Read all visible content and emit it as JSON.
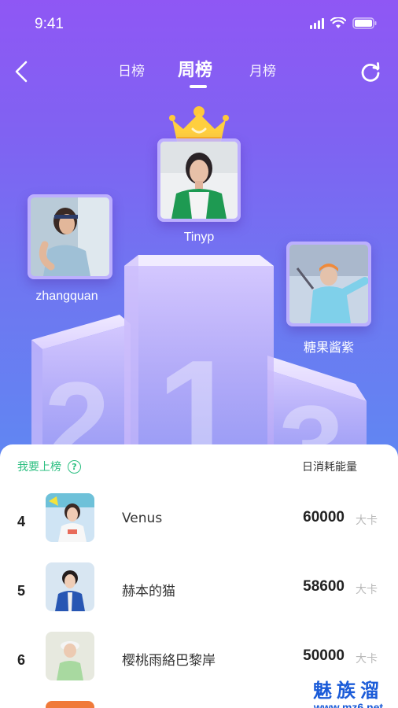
{
  "status_bar": {
    "time": "9:41"
  },
  "nav": {
    "tabs": [
      {
        "label": "日榜",
        "active": false
      },
      {
        "label": "周榜",
        "active": true
      },
      {
        "label": "月榜",
        "active": false
      }
    ]
  },
  "podium": {
    "first": {
      "rank": "1",
      "name": "Tinyp"
    },
    "second": {
      "rank": "2",
      "name": "zhangquan"
    },
    "third": {
      "rank": "3",
      "name": "糖果酱紫"
    }
  },
  "list": {
    "join_label": "我要上榜",
    "help_label": "?",
    "column_label": "日消耗能量",
    "unit": "大卡",
    "rows": [
      {
        "rank": "4",
        "name": "Venus",
        "score": "60000"
      },
      {
        "rank": "5",
        "name": "赫本的猫",
        "score": "58600"
      },
      {
        "rank": "6",
        "name": "樱桃雨絡巴黎岸",
        "score": "50000"
      }
    ]
  },
  "watermark": {
    "text": "魅族溜",
    "url": "www.mz6.net"
  },
  "colors": {
    "accent_green": "#2bbf80",
    "hero_top": "#8f57f4",
    "hero_bottom": "#5f88f2"
  }
}
